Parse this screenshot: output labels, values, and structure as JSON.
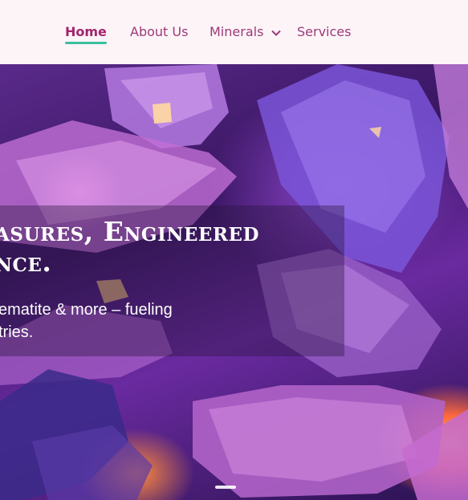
{
  "nav": {
    "items": [
      {
        "label": "Home",
        "active": true
      },
      {
        "label": "About Us"
      },
      {
        "label": "Minerals",
        "icon": "chevron-down-icon"
      },
      {
        "label": "Services"
      }
    ]
  },
  "hero": {
    "headline_line1": "asures, Engineered",
    "headline_line2": "nce.",
    "subtext_line1": "ematite & more – fueling",
    "subtext_line2": "tries."
  },
  "colors": {
    "nav_background": "#fdf4f8",
    "nav_text": "#9c3a78",
    "active_underline": "#3bbf9d"
  }
}
